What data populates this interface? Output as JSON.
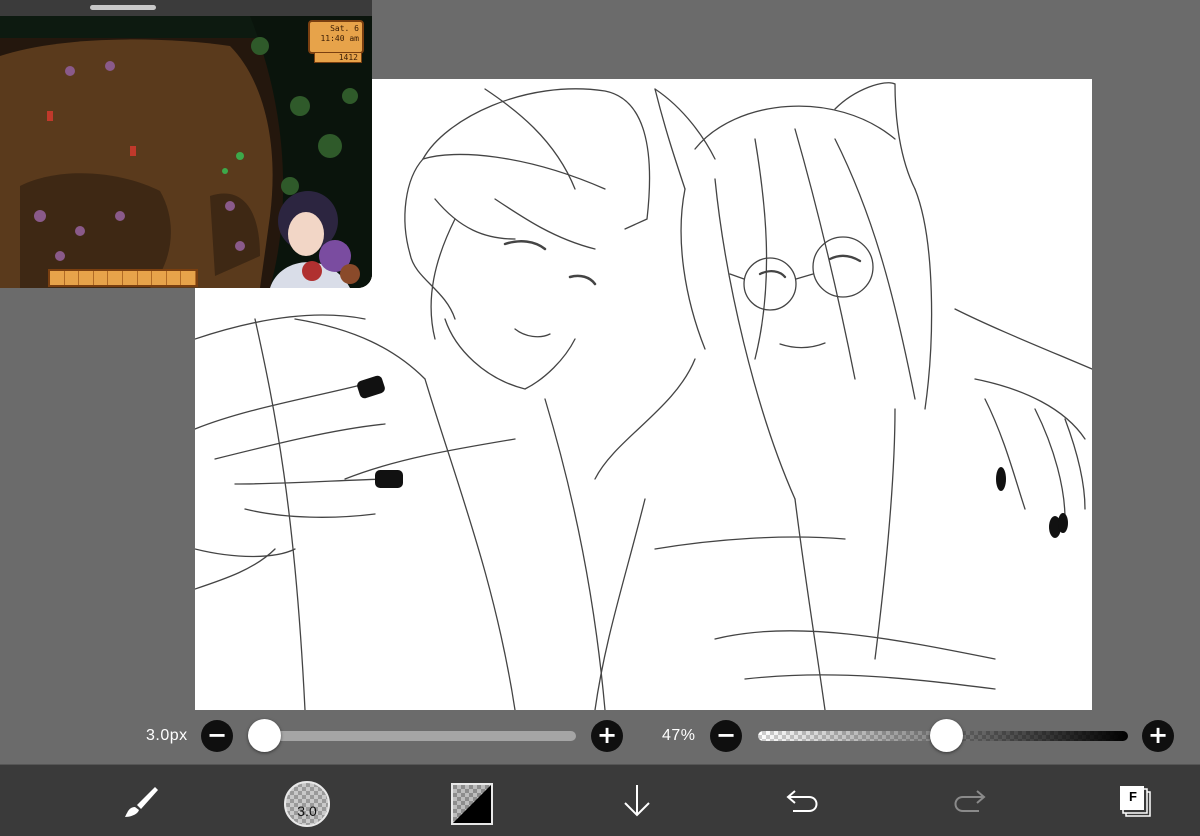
{
  "brush_size": {
    "value_label": "3.0px",
    "level": 0.01
  },
  "opacity": {
    "value_label": "47%",
    "level": 0.47
  },
  "buttons": {
    "minus": "−",
    "plus": "+"
  },
  "toolbar": {
    "brush_size_badge": "3.0",
    "layer_letter": "F",
    "items": [
      "brush-tool",
      "brush-size",
      "color",
      "move-down",
      "undo",
      "redo",
      "layers"
    ]
  },
  "game_overlay": {
    "hud_date": "Sat. 6",
    "hud_time": "11:40 am",
    "gold": "1412"
  },
  "colors": {
    "background": "#6b6b6b",
    "toolbar": "#3a3a3a",
    "canvas": "#ffffff",
    "button": "#0f0f0f"
  }
}
